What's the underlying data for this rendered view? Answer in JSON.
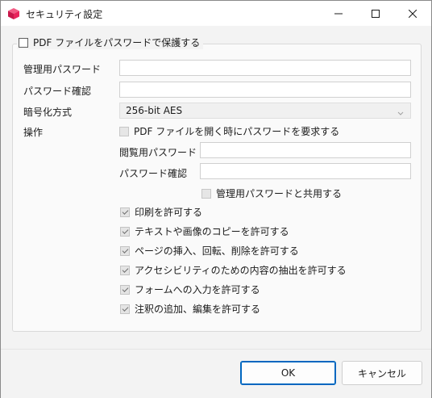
{
  "window": {
    "title": "セキュリティ設定"
  },
  "protect_checkbox": {
    "label": "PDF ファイルをパスワードで保護する",
    "checked": false
  },
  "fields": {
    "admin_password_label": "管理用パスワード",
    "admin_password_value": "",
    "confirm_password_label": "パスワード確認",
    "confirm_password_value": "",
    "encryption_label": "暗号化方式",
    "encryption_value": "256-bit AES"
  },
  "operations": {
    "label": "操作",
    "require_open_password": {
      "label": "PDF ファイルを開く時にパスワードを要求する",
      "checked": false
    },
    "view_password_label": "閲覧用パスワード",
    "view_password_value": "",
    "view_confirm_label": "パスワード確認",
    "view_confirm_value": "",
    "share_with_admin": {
      "label": "管理用パスワードと共用する",
      "checked": false
    },
    "permissions": [
      {
        "label": "印刷を許可する",
        "checked": true
      },
      {
        "label": "テキストや画像のコピーを許可する",
        "checked": true
      },
      {
        "label": "ページの挿入、回転、削除を許可する",
        "checked": true
      },
      {
        "label": "アクセシビリティのための内容の抽出を許可する",
        "checked": true
      },
      {
        "label": "フォームへの入力を許可する",
        "checked": true
      },
      {
        "label": "注釈の追加、編集を許可する",
        "checked": true
      }
    ]
  },
  "buttons": {
    "ok": "OK",
    "cancel": "キャンセル"
  },
  "colors": {
    "accent": "#0067c0",
    "app_icon": "#e8245c"
  }
}
